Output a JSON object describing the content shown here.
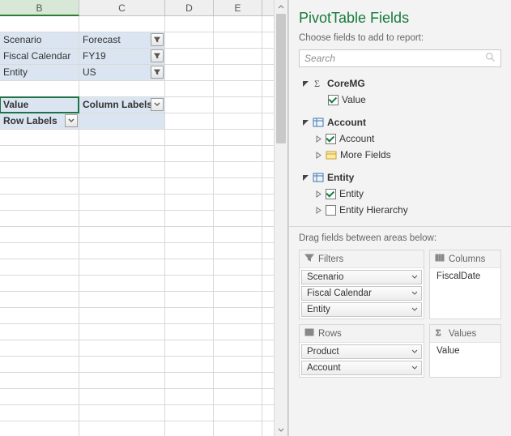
{
  "columns": [
    "B",
    "C",
    "D",
    "E"
  ],
  "filters": [
    {
      "label": "Scenario",
      "value": "Forecast"
    },
    {
      "label": "Fiscal Calendar",
      "value": "FY19"
    },
    {
      "label": "Entity",
      "value": "US"
    }
  ],
  "pivot_headers": {
    "value_label": "Value",
    "column_labels": "Column Labels",
    "row_labels": "Row Labels"
  },
  "pane": {
    "title": "PivotTable Fields",
    "hint": "Choose fields to add to report:",
    "search_placeholder": "Search",
    "drag_hint": "Drag fields between areas below:",
    "groups": {
      "coremg": {
        "label": "CoreMG",
        "value": "Value"
      },
      "account": {
        "label": "Account",
        "account": "Account",
        "more": "More Fields"
      },
      "entity": {
        "label": "Entity",
        "entity": "Entity",
        "hierarchy": "Entity Hierarchy"
      }
    },
    "areas": {
      "filters": {
        "title": "Filters",
        "items": [
          "Scenario",
          "Fiscal Calendar",
          "Entity"
        ]
      },
      "columns": {
        "title": "Columns",
        "items": [
          "FiscalDate"
        ]
      },
      "rows": {
        "title": "Rows",
        "items": [
          "Product",
          "Account"
        ]
      },
      "values": {
        "title": "Values",
        "items": [
          "Value"
        ]
      }
    }
  }
}
